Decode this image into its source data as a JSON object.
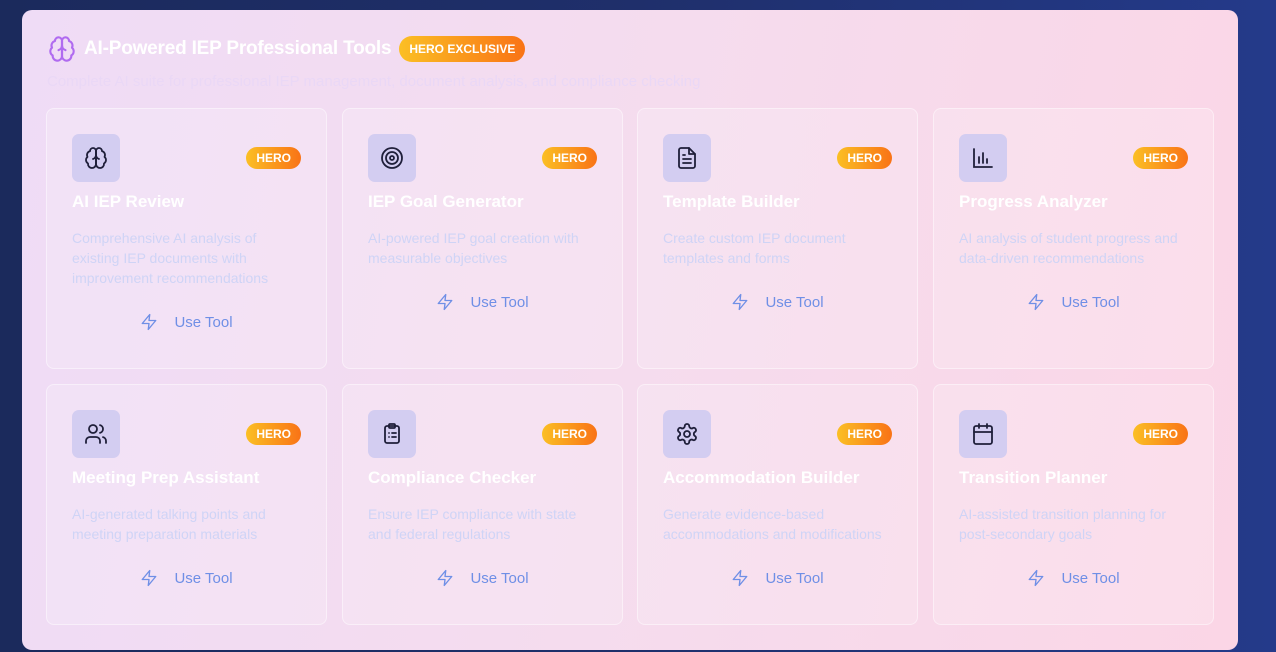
{
  "header": {
    "title": "AI-Powered IEP Professional Tools",
    "badge": "HERO EXCLUSIVE",
    "subtitle": "Complete AI suite for professional IEP management, document analysis, and compliance checking"
  },
  "tools": [
    {
      "name": "AI IEP Review",
      "badge": "HERO",
      "description": "Comprehensive AI analysis of existing IEP documents with improvement recommendations",
      "action": "Use Tool",
      "icon": "brain-icon"
    },
    {
      "name": "IEP Goal Generator",
      "badge": "HERO",
      "description": "AI-powered IEP goal creation with measurable objectives",
      "action": "Use Tool",
      "icon": "target-icon"
    },
    {
      "name": "Template Builder",
      "badge": "HERO",
      "description": "Create custom IEP document templates and forms",
      "action": "Use Tool",
      "icon": "document-icon"
    },
    {
      "name": "Progress Analyzer",
      "badge": "HERO",
      "description": "AI analysis of student progress and data-driven recommendations",
      "action": "Use Tool",
      "icon": "bar-chart-icon"
    },
    {
      "name": "Meeting Prep Assistant",
      "badge": "HERO",
      "description": "AI-generated talking points and meeting preparation materials",
      "action": "Use Tool",
      "icon": "users-icon"
    },
    {
      "name": "Compliance Checker",
      "badge": "HERO",
      "description": "Ensure IEP compliance with state and federal regulations",
      "action": "Use Tool",
      "icon": "clipboard-list-icon"
    },
    {
      "name": "Accommodation Builder",
      "badge": "HERO",
      "description": "Generate evidence-based accommodations and modifications",
      "action": "Use Tool",
      "icon": "gear-icon"
    },
    {
      "name": "Transition Planner",
      "badge": "HERO",
      "description": "AI-assisted transition planning for post-secondary goals",
      "action": "Use Tool",
      "icon": "calendar-icon"
    }
  ],
  "colors": {
    "accent_badge_start": "#fbbf24",
    "accent_badge_end": "#f97316",
    "action_blue": "#6f8fe6",
    "icon_box": "#d3cdf1"
  }
}
